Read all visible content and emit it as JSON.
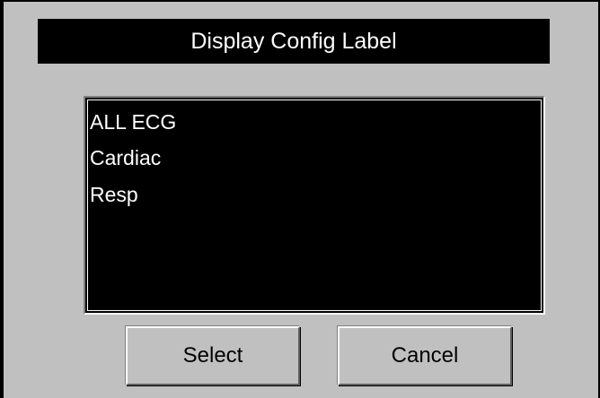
{
  "dialog": {
    "title": "Display Config Label",
    "list": {
      "items": [
        {
          "label": "ALL ECG"
        },
        {
          "label": "Cardiac"
        },
        {
          "label": "Resp"
        }
      ]
    },
    "buttons": {
      "select_label": "Select",
      "cancel_label": "Cancel"
    }
  },
  "colors": {
    "panel_background": "#c0c0c0",
    "title_bar_background": "#000000",
    "title_text": "#ffffff",
    "list_background": "#000000",
    "list_text": "#ffffff"
  }
}
